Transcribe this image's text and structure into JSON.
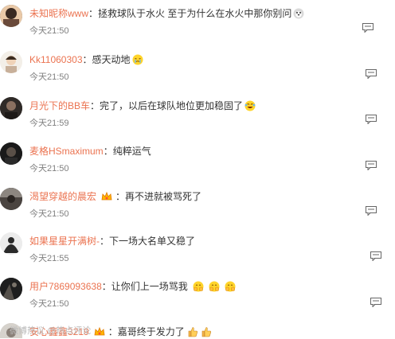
{
  "comments": [
    {
      "user": "未知昵称www",
      "sep": "：",
      "text": "拯救球队于水火 至于为什么在水火中那你别问",
      "time": "今天21:50",
      "emoji": [
        "dog-face-icon"
      ],
      "badge": ""
    },
    {
      "user": "Kk11060303",
      "sep": "：",
      "text": "感天动地",
      "time": "今天21:50",
      "emoji": [
        "touched-face-icon"
      ],
      "badge": ""
    },
    {
      "user": "月光下的BB车",
      "sep": "：",
      "text": "完了，以后在球队地位更加稳固了",
      "time": "今天21:59",
      "emoji": [
        "laugh-cry-face-icon"
      ],
      "badge": ""
    },
    {
      "user": "麦格HSmaximum",
      "sep": "：",
      "text": "纯粹运气",
      "time": "今天21:50",
      "emoji": [],
      "badge": ""
    },
    {
      "user": "渴望穿越的晨宏",
      "sep": "：",
      "text": "再不进就被骂死了",
      "time": "今天21:50",
      "emoji": [],
      "badge": "crown-badge-icon"
    },
    {
      "user": "如果星星开满树-",
      "sep": "：",
      "text": "下一场大名单又稳了",
      "time": "今天21:55",
      "emoji": [],
      "badge": ""
    },
    {
      "user": "用户7869093638",
      "sep": "：",
      "text": "让你们上一场骂我",
      "time": "今天21:50",
      "emoji": [
        "cover-face-icon",
        "cover-face-icon",
        "cover-face-icon"
      ],
      "badge": ""
    },
    {
      "user": "安心鑫鑫3219",
      "sep": "：",
      "text": "嘉哥终于发力了",
      "time": "",
      "emoji": [
        "thumbs-up-icon",
        "thumbs-up-icon"
      ],
      "badge": "crown-badge-icon"
    }
  ],
  "watermark": "微博热议 @热点评论",
  "colors": {
    "username": "#eb7350",
    "text": "#333333",
    "time": "#808080"
  }
}
